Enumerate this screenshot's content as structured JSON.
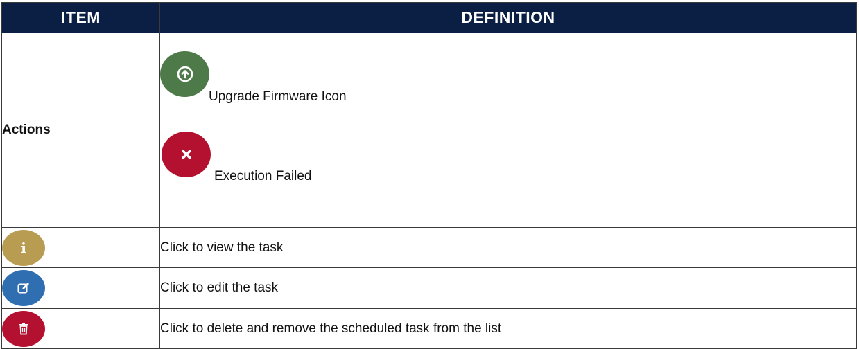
{
  "header": {
    "item": "ITEM",
    "definition": "DEFINITION"
  },
  "rows": {
    "actions": {
      "item": "Actions",
      "entries": [
        {
          "icon": "upgrade-arrow-icon",
          "color": "#4e7a4a",
          "label": "Upgrade Firmware Icon"
        },
        {
          "icon": "close-x-icon",
          "color": "#b4102f",
          "label": "Execution Failed"
        }
      ]
    },
    "view": {
      "icon": "info-icon",
      "color": "#b89c52",
      "definition": "Click to view the task"
    },
    "edit": {
      "icon": "edit-icon",
      "color": "#2f6fb1",
      "definition": "Click to edit the task"
    },
    "delete": {
      "icon": "trash-icon",
      "color": "#b4102f",
      "definition": "Click to delete and remove the scheduled task from the list"
    }
  }
}
